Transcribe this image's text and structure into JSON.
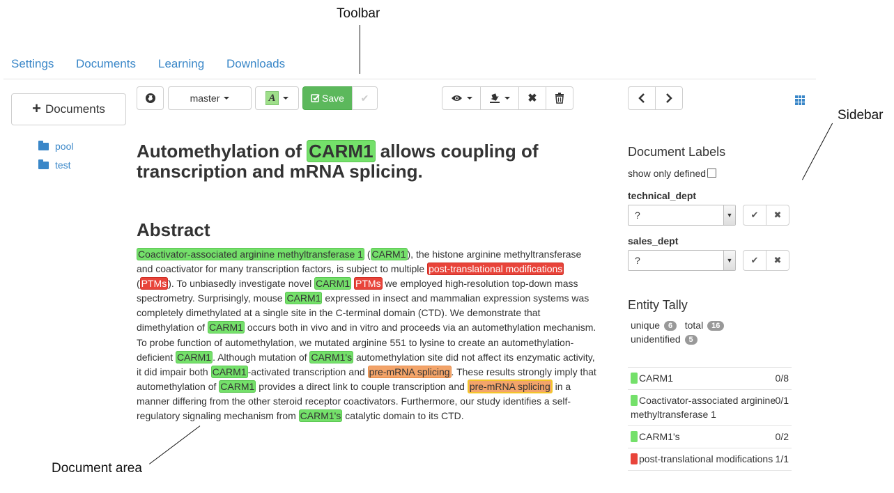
{
  "annotations": {
    "toolbar": "Toolbar",
    "sidebar": "Sidebar",
    "document_area": "Document area"
  },
  "nav": {
    "items": [
      {
        "label": "Settings"
      },
      {
        "label": "Documents"
      },
      {
        "label": "Learning"
      },
      {
        "label": "Downloads"
      }
    ]
  },
  "left_sidebar": {
    "documents_button": "Documents",
    "folders": [
      {
        "label": "pool",
        "icon": "folder-icon"
      },
      {
        "label": "test",
        "icon": "folder-icon"
      }
    ]
  },
  "toolbar": {
    "branch_label": "master",
    "save_label": "Save",
    "icons": [
      "globe-icon",
      "annotate-icon",
      "save-icon",
      "check-icon",
      "eye-icon",
      "download-icon",
      "close-icon",
      "trash-icon",
      "chevron-left-icon",
      "chevron-right-icon",
      "grid-icon"
    ]
  },
  "document": {
    "title_before": "Automethylation of ",
    "title_entity": "CARM1",
    "title_after": " allows coupling of transcription and mRNA splicing.",
    "abstract_heading": "Abstract",
    "segments": [
      {
        "t": "Coactivator-associated arginine methyltransferase 1",
        "c": "g"
      },
      {
        "t": " (",
        "c": ""
      },
      {
        "t": "CARM1",
        "c": "g"
      },
      {
        "t": "), the histone arginine methyltransferase and coactivator for many transcription factors, is subject to multiple ",
        "c": ""
      },
      {
        "t": "post-translational modifications",
        "c": "r"
      },
      {
        "t": " (",
        "c": ""
      },
      {
        "t": "PTMs",
        "c": "r"
      },
      {
        "t": "). To unbiasedly investigate novel ",
        "c": ""
      },
      {
        "t": "CARM1",
        "c": "g"
      },
      {
        "t": " ",
        "c": ""
      },
      {
        "t": "PTMs",
        "c": "r"
      },
      {
        "t": " we employed high-resolution top-down mass spectrometry. Surprisingly, mouse ",
        "c": ""
      },
      {
        "t": "CARM1",
        "c": "g"
      },
      {
        "t": " expressed in insect and mammalian expression systems was completely dimethylated at a single site in the C-terminal domain (CTD). We demonstrate that dimethylation of ",
        "c": ""
      },
      {
        "t": "CARM1",
        "c": "g"
      },
      {
        "t": " occurs both in vivo and in vitro and proceeds via an automethylation mechanism. To probe function of automethylation, we mutated arginine 551 to lysine to create an automethylation-deficient ",
        "c": ""
      },
      {
        "t": "CARM1",
        "c": "g"
      },
      {
        "t": ". Although mutation of ",
        "c": ""
      },
      {
        "t": "CARM1's",
        "c": "g"
      },
      {
        "t": " automethylation site did not affect its enzymatic activity, it did impair both ",
        "c": ""
      },
      {
        "t": "CARM1",
        "c": "g"
      },
      {
        "t": "-activated transcription and ",
        "c": ""
      },
      {
        "t": "pre-mRNA splicing",
        "c": "o"
      },
      {
        "t": ". These results strongly imply that automethylation of ",
        "c": ""
      },
      {
        "t": "CARM1",
        "c": "g"
      },
      {
        "t": " provides a direct link to couple transcription and ",
        "c": ""
      },
      {
        "t": "pre-mRNA splicing",
        "c": "of"
      },
      {
        "t": " in a manner differing from the other steroid receptor coactivators. Furthermore, our study identifies a self-regulatory signaling mechanism from ",
        "c": ""
      },
      {
        "t": "CARM1's",
        "c": "g"
      },
      {
        "t": " catalytic domain to its CTD.",
        "c": ""
      }
    ]
  },
  "labels_panel": {
    "heading": "Document Labels",
    "show_only_defined": "show only defined",
    "fields": [
      {
        "name": "technical_dept",
        "value": "?"
      },
      {
        "name": "sales_dept",
        "value": "?"
      }
    ]
  },
  "tally_panel": {
    "heading": "Entity Tally",
    "unique_label": "unique",
    "unique_count": "6",
    "total_label": "total",
    "total_count": "16",
    "unidentified_label": "unidentified",
    "unidentified_count": "5",
    "rows": [
      {
        "name": "CARM1",
        "count": "0/8",
        "color": "#74e06a"
      },
      {
        "name": "Coactivator-associated arginine methyltransferase 1",
        "count": "0/1",
        "color": "#74e06a"
      },
      {
        "name": "CARM1's",
        "count": "0/2",
        "color": "#74e06a"
      },
      {
        "name": "post-translational modifications",
        "count": "1/1",
        "color": "#e8443a"
      }
    ]
  },
  "colors": {
    "link": "#3a87c8",
    "save": "#5cb85c",
    "entity_green": "#74e06a",
    "entity_red": "#e8443a",
    "entity_orange": "#f3a46a"
  }
}
